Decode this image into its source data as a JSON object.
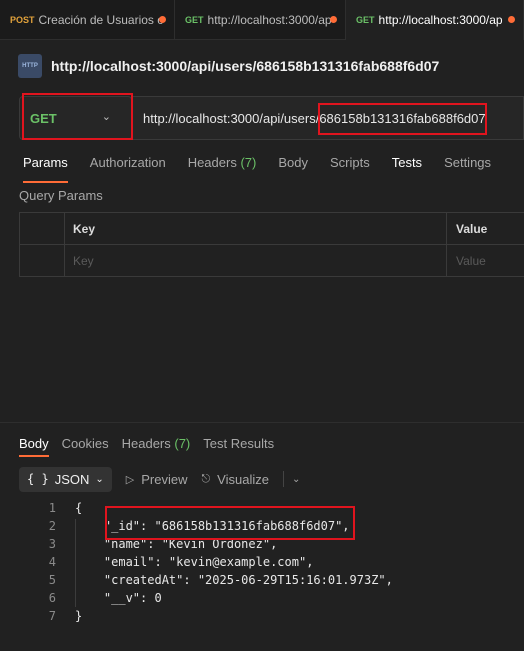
{
  "tabs": [
    {
      "method": "POST",
      "label": "Creación de Usuarios c"
    },
    {
      "method": "GET",
      "label": "http://localhost:3000/ap"
    },
    {
      "method": "GET",
      "label": "http://localhost:3000/ap"
    }
  ],
  "request": {
    "title": "http://localhost:3000/api/users/686158b131316fab688f6d07",
    "method": "GET",
    "url": "http://localhost:3000/api/users/686158b131316fab688f6d07",
    "tabs": {
      "params": "Params",
      "authorization": "Authorization",
      "headers": "Headers",
      "headers_count": "(7)",
      "body": "Body",
      "scripts": "Scripts",
      "tests": "Tests",
      "settings": "Settings"
    },
    "query_params_label": "Query Params",
    "table": {
      "key_header": "Key",
      "value_header": "Value",
      "key_placeholder": "Key",
      "value_placeholder": "Value"
    }
  },
  "response": {
    "tabs": {
      "body": "Body",
      "cookies": "Cookies",
      "headers": "Headers",
      "headers_count": "(7)",
      "test_results": "Test Results"
    },
    "format": {
      "braces": "{ }",
      "label": "JSON",
      "preview": "Preview",
      "visualize": "Visualize"
    },
    "code_lines": [
      {
        "num": "1",
        "text": "{"
      },
      {
        "num": "2",
        "text": "    \"_id\": \"686158b131316fab688f6d07\","
      },
      {
        "num": "3",
        "text": "    \"name\": \"Kevin Ordonez\","
      },
      {
        "num": "4",
        "text": "    \"email\": \"kevin@example.com\","
      },
      {
        "num": "5",
        "text": "    \"createdAt\": \"2025-06-29T15:16:01.973Z\","
      },
      {
        "num": "6",
        "text": "    \"__v\": 0"
      },
      {
        "num": "7",
        "text": "}"
      }
    ]
  },
  "colors": {
    "accent": "#ff6c37",
    "get": "#6bc167",
    "post": "#e2a23b",
    "highlight_box": "#e0141e"
  }
}
